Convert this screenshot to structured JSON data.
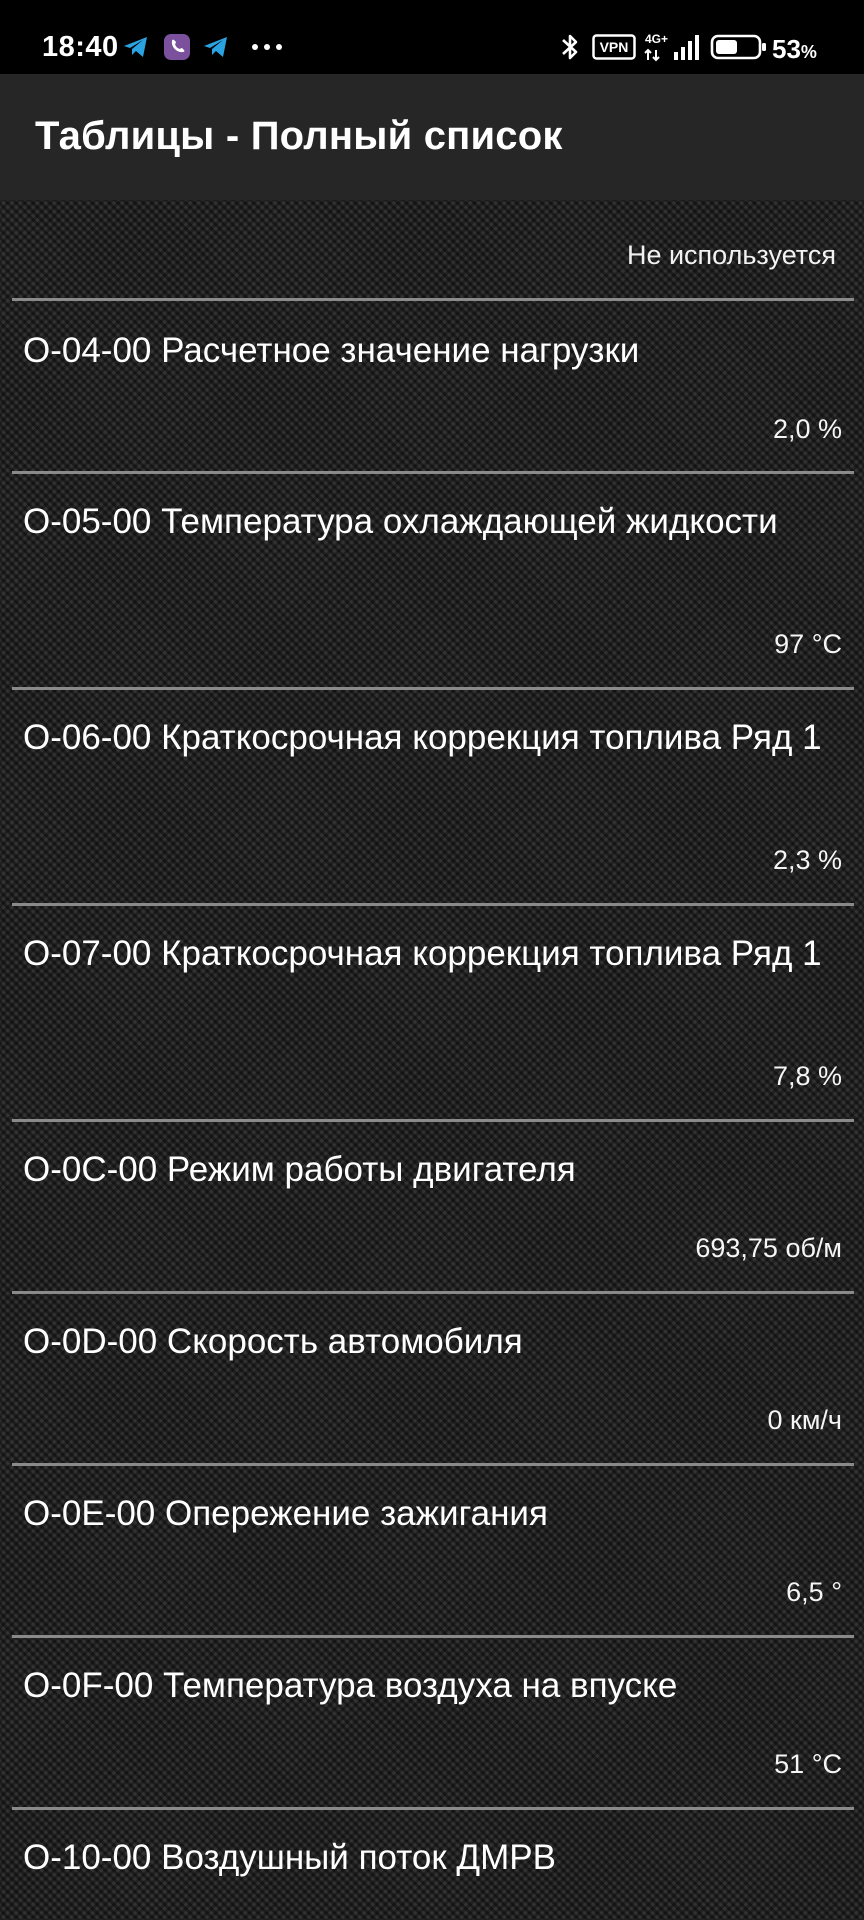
{
  "status_bar": {
    "time": "18:40",
    "notification_icons": [
      "telegram-icon",
      "viber-icon",
      "telegram-icon",
      "more-notifications-icon"
    ],
    "system_icons": [
      "bluetooth-icon",
      "vpn-icon",
      "signal-4g-icon",
      "battery-icon"
    ],
    "vpn_label": "VPN",
    "network_label": "4G+",
    "battery_percent": "53",
    "battery_unit": "%",
    "battery_level": 0.53
  },
  "app_bar": {
    "title": "Таблицы - Полный список"
  },
  "list": {
    "header_value": "Не используется",
    "rows": [
      {
        "title": "O-04-00 Расчетное значение нагрузки",
        "value": "2,0 %"
      },
      {
        "title": "O-05-00 Температура охлаждающей жидкости",
        "value": "97 °C"
      },
      {
        "title": "O-06-00 Краткосрочная коррекция топлива Ряд 1",
        "value": "2,3 %"
      },
      {
        "title": "O-07-00 Краткосрочная коррекция топлива Ряд 1",
        "value": "7,8 %"
      },
      {
        "title": "O-0C-00 Режим работы двигателя",
        "value": "693,75 об/м"
      },
      {
        "title": "O-0D-00 Скорость автомобиля",
        "value": "0 км/ч"
      },
      {
        "title": "O-0E-00 Опережение зажигания",
        "value": "6,5 °"
      },
      {
        "title": "O-0F-00 Температура воздуха на впуске",
        "value": "51 °C"
      },
      {
        "title": "O-10-00 Воздушный поток ДМРВ",
        "value": ""
      }
    ]
  },
  "colors": {
    "status_bar_bg": "#000000",
    "app_bar_bg": "#262626",
    "list_bg": "#2a2a2a",
    "divider": "#8a8a8a",
    "text": "#ffffff"
  }
}
